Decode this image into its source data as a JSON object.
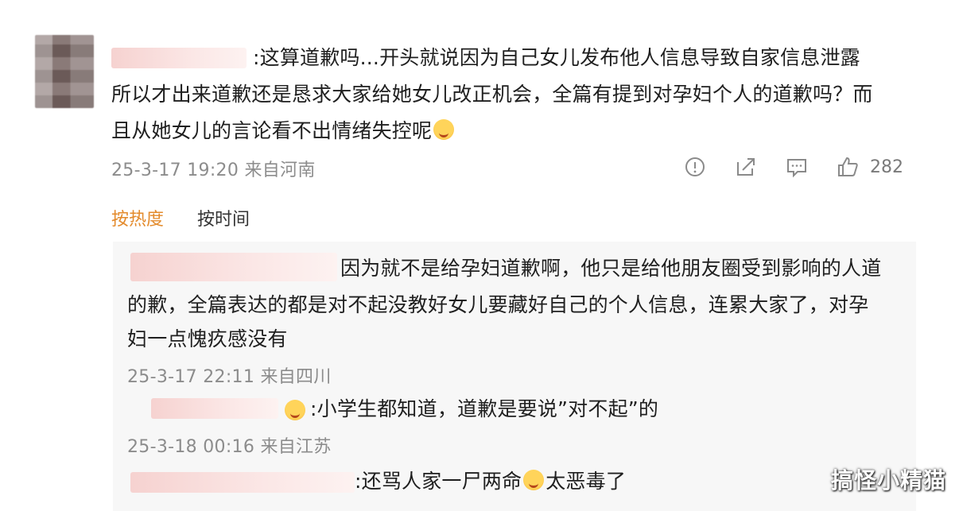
{
  "comment": {
    "text_line1": ":这算道歉吗...开头就说因为自己女儿发布他人信息导致自家信息泄露",
    "text_line2": "所以才出来道歉还是恳求大家给她女儿改正机会，全篇有提到对孕妇个人的道歉吗？而",
    "text_line3": "且从她女儿的言论看不出情绪失控呢",
    "meta": "25-3-17 19:20 来自河南",
    "like_count": "282",
    "icons": [
      "report-icon",
      "share-icon",
      "comment-icon",
      "like-icon"
    ]
  },
  "sort_tabs": {
    "hot": "按热度",
    "time": "按时间",
    "active_color": "#e38a2b"
  },
  "replies": [
    {
      "line1": "因为就不是给孕妇道歉啊，他只是给他朋友圈受到影响的人道",
      "line2": "的歉，全篇表达的都是对不起没教好女儿要藏好自己的个人信息，连累大家了，对孕",
      "line3": "妇一点愧疚感没有",
      "meta": "25-3-17 22:11 来自四川"
    },
    {
      "line1": ":小学生都知道，道歉是要说”对不起”的",
      "meta": "25-3-18 00:16 来自江苏"
    },
    {
      "line1": ":还骂人家一尸两命",
      "line1_after": "太恶毒了"
    }
  ],
  "watermark": "搞怪小精猫"
}
